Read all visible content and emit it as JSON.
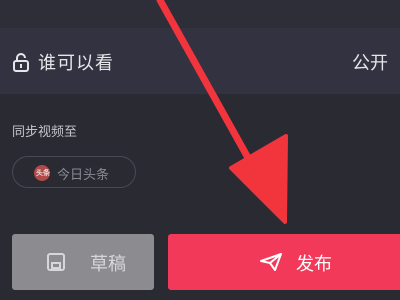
{
  "privacy": {
    "label": "谁可以看",
    "value": "公开"
  },
  "sync": {
    "label": "同步视频至",
    "targets": [
      {
        "label": "今日头条",
        "icon_text": "头条"
      }
    ]
  },
  "actions": {
    "draft_label": "草稿",
    "publish_label": "发布"
  },
  "icons": {
    "privacy": "lock-icon",
    "draft": "save-icon",
    "publish": "paper-plane-icon",
    "annotation": "red-arrow"
  },
  "colors": {
    "background": "#2a2a33",
    "publish_button": "#f2395a",
    "draft_button": "#8b8b90",
    "annotation_arrow": "#f2353d"
  }
}
